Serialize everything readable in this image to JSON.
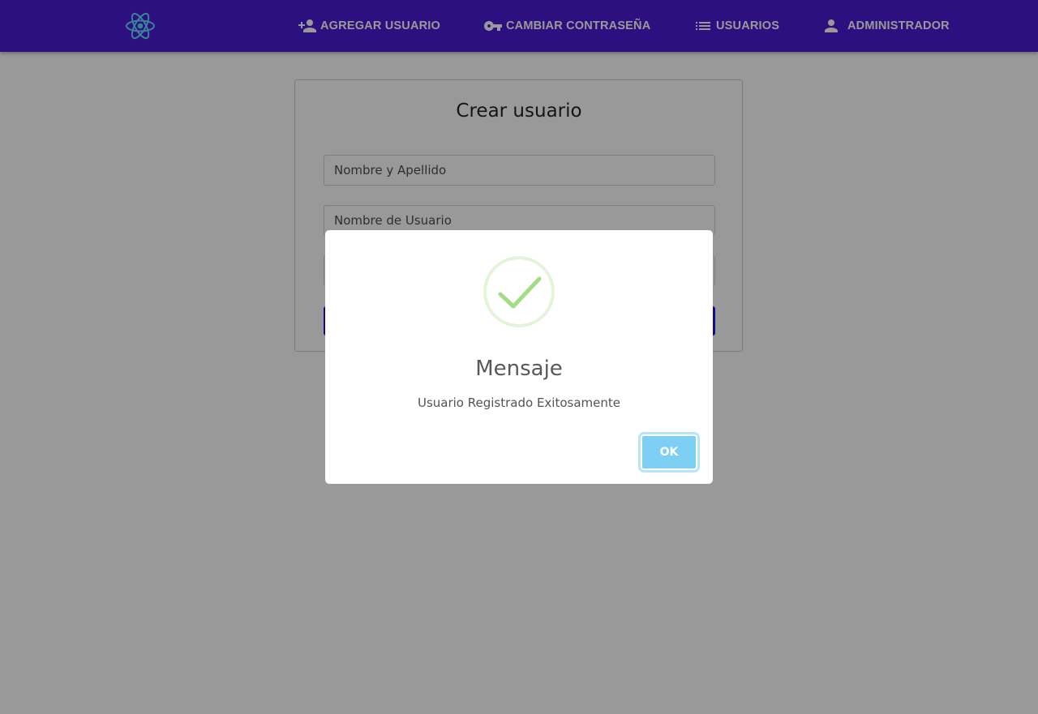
{
  "navbar": {
    "background_color": "#4b1bd6",
    "logo_icon": "react-atom-icon",
    "items": [
      {
        "label": "AGREGAR USUARIO",
        "icon": "person-add-icon"
      },
      {
        "label": "CAMBIAR CONTRASEÑA",
        "icon": "key-icon"
      },
      {
        "label": "USUARIOS",
        "icon": "list-icon"
      },
      {
        "label": "ADMINISTRADOR",
        "icon": "person-icon"
      }
    ]
  },
  "form": {
    "title": "Crear usuario",
    "fields": [
      {
        "placeholder": "Nombre y Apellido",
        "value": ""
      },
      {
        "placeholder": "Nombre de Usuario",
        "value": ""
      },
      {
        "placeholder": "",
        "value": ""
      }
    ],
    "submit_color": "#1b12f2"
  },
  "modal": {
    "icon": "success-check-icon",
    "title": "Mensaje",
    "text": "Usuario Registrado Exitosamente",
    "ok_label": "OK",
    "ok_color": "#7ecff4",
    "check_color": "#a5dc86"
  }
}
